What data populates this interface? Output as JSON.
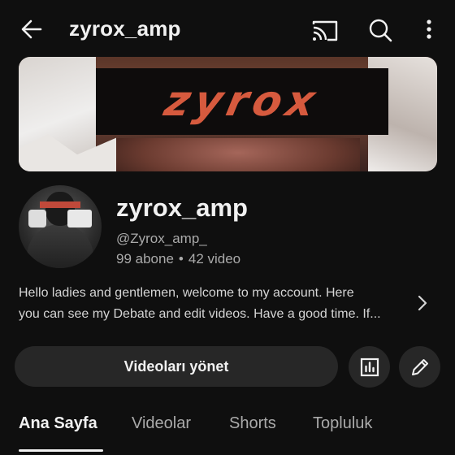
{
  "header": {
    "title": "zyrox_amp",
    "back_icon": "arrow-left-icon",
    "cast_icon": "cast-icon",
    "search_icon": "search-icon",
    "more_icon": "more-vertical-icon"
  },
  "banner": {
    "logo_text": "zyrox"
  },
  "channel": {
    "name": "zyrox_amp",
    "handle": "@Zyrox_amp_",
    "subscribers": "99 abone",
    "separator": "•",
    "videos": "42 video",
    "description_line1": "Hello ladies and gentlemen, welcome to my account. Here",
    "description_line2": "you can see my Debate and edit videos. Have a good time. If..."
  },
  "actions": {
    "manage_videos_label": "Videoları yönet",
    "analytics_icon": "bar-chart-icon",
    "edit_icon": "pencil-icon"
  },
  "tabs": [
    {
      "label": "Ana Sayfa",
      "active": true
    },
    {
      "label": "Videolar",
      "active": false
    },
    {
      "label": "Shorts",
      "active": false
    },
    {
      "label": "Topluluk",
      "active": false
    }
  ],
  "colors": {
    "background": "#0f0f0f",
    "button_bg": "#272727",
    "secondary_text": "#aaaaaa",
    "logo_orange": "#d65a3e"
  }
}
